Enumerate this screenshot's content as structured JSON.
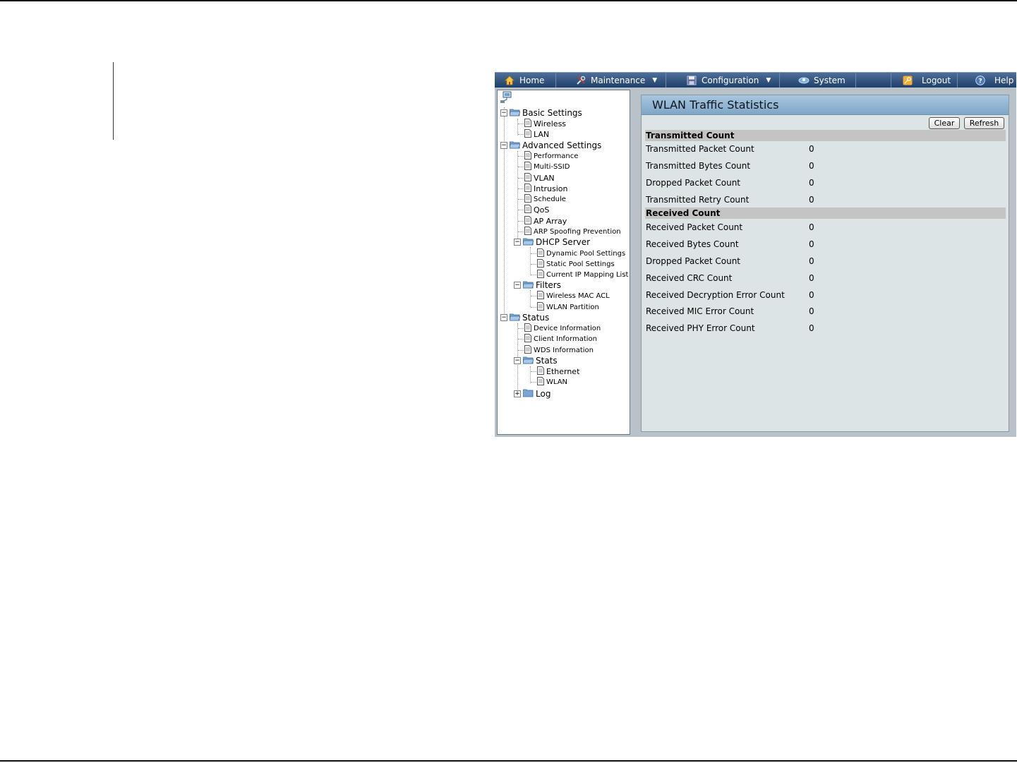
{
  "nav": {
    "home": "Home",
    "maintenance": "Maintenance",
    "configuration": "Configuration",
    "system": "System",
    "logout": "Logout",
    "help": "Help"
  },
  "tree": {
    "basic_settings": "Basic Settings",
    "wireless": "Wireless",
    "lan": "LAN",
    "advanced_settings": "Advanced Settings",
    "performance": "Performance",
    "multi_ssid": "Multi-SSID",
    "vlan": "VLAN",
    "intrusion": "Intrusion",
    "schedule": "Schedule",
    "qos": "QoS",
    "ap_array": "AP Array",
    "arp_spoofing": "ARP Spoofing Prevention",
    "dhcp_server": "DHCP Server",
    "dynamic_pool": "Dynamic Pool Settings",
    "static_pool": "Static Pool Settings",
    "current_ip_mapping": "Current IP Mapping List",
    "filters": "Filters",
    "wireless_mac_acl": "Wireless MAC ACL",
    "wlan_partition": "WLAN Partition",
    "status": "Status",
    "device_information": "Device Information",
    "client_information": "Client Information",
    "wds_information": "WDS Information",
    "stats": "Stats",
    "ethernet": "Ethernet",
    "wlan": "WLAN",
    "log": "Log"
  },
  "content": {
    "title": "WLAN Traffic Statistics",
    "clear_label": "Clear",
    "refresh_label": "Refresh",
    "transmitted": {
      "heading": "Transmitted Count",
      "rows": [
        {
          "label": "Transmitted Packet Count",
          "value": "0"
        },
        {
          "label": "Transmitted Bytes Count",
          "value": "0"
        },
        {
          "label": "Dropped Packet Count",
          "value": "0"
        },
        {
          "label": "Transmitted Retry Count",
          "value": "0"
        }
      ]
    },
    "received": {
      "heading": "Received Count",
      "rows": [
        {
          "label": "Received Packet Count",
          "value": "0"
        },
        {
          "label": "Received Bytes Count",
          "value": "0"
        },
        {
          "label": "Dropped Packet Count",
          "value": "0"
        },
        {
          "label": "Received CRC Count",
          "value": "0"
        },
        {
          "label": "Received Decryption Error Count",
          "value": "0"
        },
        {
          "label": "Received MIC Error Count",
          "value": "0"
        },
        {
          "label": "Received PHY Error Count",
          "value": "0"
        }
      ]
    }
  },
  "colors": {
    "navbar": "#2c4a76",
    "title_bar": "#8fb2d1",
    "section_header": "#c4c4c4",
    "panel_bg": "#dde4e6"
  },
  "icons": {
    "home": "home-icon",
    "maintenance": "tools-icon",
    "configuration": "save-disk-icon",
    "system": "system-icon",
    "logout": "key-icon",
    "help": "help-icon",
    "folder": "folder-icon",
    "page": "page-icon",
    "network": "network-icon"
  }
}
